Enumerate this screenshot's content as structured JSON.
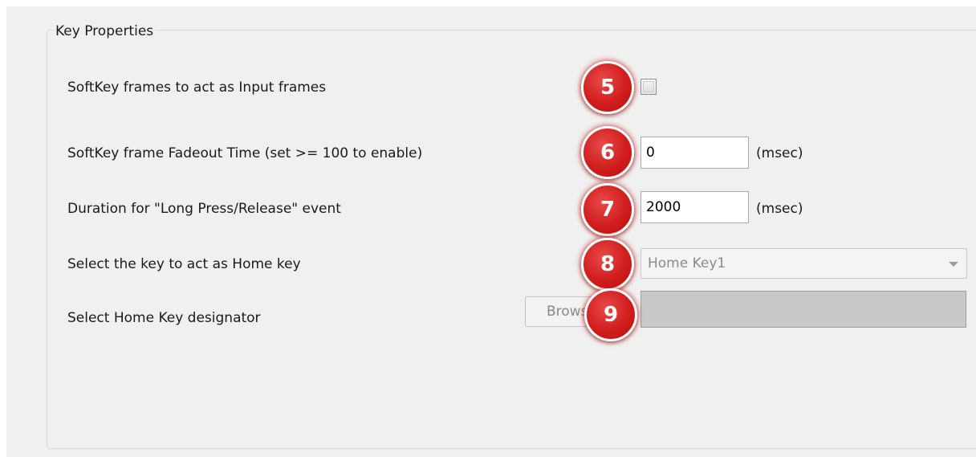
{
  "group": {
    "title": "Key Properties"
  },
  "rows": {
    "input_frames": {
      "label": "SoftKey frames to act as Input frames",
      "badge": "5",
      "checked": false
    },
    "fadeout_time": {
      "label": "SoftKey frame Fadeout Time (set >= 100 to enable)",
      "badge": "6",
      "value": "0",
      "unit": "(msec)"
    },
    "long_press": {
      "label": "Duration for \"Long Press/Release\" event",
      "badge": "7",
      "value": "2000",
      "unit": "(msec)"
    },
    "home_key": {
      "label": "Select the key to act as Home key",
      "badge": "8",
      "selected": "Home Key1"
    },
    "designator": {
      "label": "Select Home Key designator",
      "badge": "9",
      "browse_label": "Browse..."
    }
  },
  "colors": {
    "badge_red": "#d11d1d",
    "panel_bg": "#f0f0f0",
    "designator_fill": "#c9c9c9"
  }
}
